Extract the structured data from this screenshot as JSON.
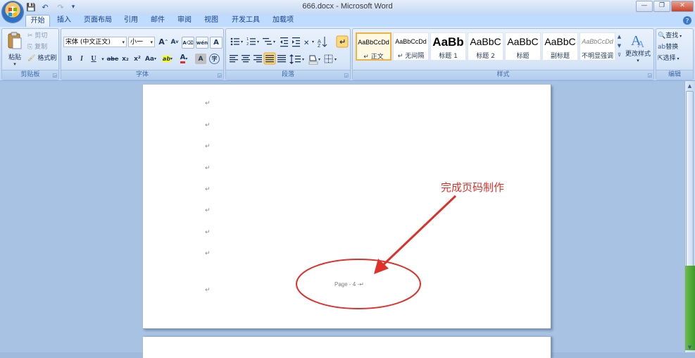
{
  "window": {
    "title": "666.docx - Microsoft Word",
    "controls": [
      "—",
      "❐",
      "✕"
    ]
  },
  "quick_access": {
    "save": "💾",
    "undo": "↶",
    "redo": "↷",
    "customize": "▾"
  },
  "tabs": [
    {
      "label": "开始",
      "active": true
    },
    {
      "label": "插入"
    },
    {
      "label": "页面布局"
    },
    {
      "label": "引用"
    },
    {
      "label": "邮件"
    },
    {
      "label": "审阅"
    },
    {
      "label": "视图"
    },
    {
      "label": "开发工具"
    },
    {
      "label": "加载项"
    }
  ],
  "clipboard": {
    "group_label": "剪贴板",
    "paste": "粘贴",
    "cut": "剪切",
    "copy": "复制",
    "format_painter": "格式刷"
  },
  "font": {
    "group_label": "字体",
    "font_name": "宋体 (中文正文)",
    "font_size": "小一",
    "grow": "A",
    "shrink": "A",
    "phonetic": "wén",
    "clear": "A",
    "border_char": "A",
    "bold": "B",
    "italic": "I",
    "underline": "U",
    "strike": "abe",
    "subscript": "x₂",
    "superscript": "x²",
    "change_case": "Aa",
    "highlight": "ab",
    "font_color": "A",
    "shading": "A",
    "enclose": "字"
  },
  "paragraph": {
    "group_label": "段落"
  },
  "styles": {
    "group_label": "样式",
    "items": [
      {
        "preview": "AaBbCcDd",
        "name": "↵ 正文",
        "selected": true
      },
      {
        "preview": "AaBbCcDd",
        "name": "↵ 无间隔"
      },
      {
        "preview": "AaBb",
        "name": "标题 1"
      },
      {
        "preview": "AaBbC",
        "name": "标题 2"
      },
      {
        "preview": "AaBbC",
        "name": "标题"
      },
      {
        "preview": "AaBbC",
        "name": "副标题"
      },
      {
        "preview": "AaBbCcDd",
        "name": "不明显强调"
      }
    ],
    "change_styles": "更改样式"
  },
  "editing": {
    "group_label": "编辑",
    "find": "查找",
    "replace": "替换",
    "select": "选择"
  },
  "document": {
    "paragraph_mark": "↵",
    "footer_text": "Page - 4 -↵",
    "annotation": "完成页码制作"
  },
  "colors": {
    "annotation_red": "#e0302a",
    "ribbon_blue": "#bfdbff"
  }
}
